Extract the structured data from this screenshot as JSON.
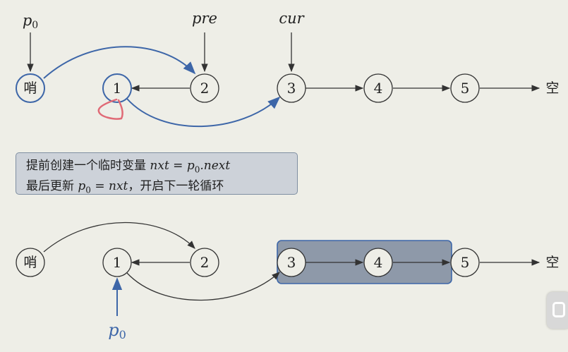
{
  "colors": {
    "background": "#eeeee7",
    "node_fill": "#eeeee7",
    "node_stroke": "#333333",
    "highlight": "#3d66a8",
    "group_box_fill": "#8e99a9",
    "group_box_stroke": "#3d66a8",
    "note_fill": "#cdd2d9",
    "annotation": "#e06a76"
  },
  "top": {
    "nodes": [
      "哨",
      "1",
      "2",
      "3",
      "4",
      "5"
    ],
    "terminal": "空",
    "pointers": {
      "p0": "p",
      "p0_sub": "0",
      "pre": "pre",
      "cur": "cur"
    }
  },
  "note": {
    "line1_prefix": "提前创建一个临时变量 ",
    "line1_math": "nxt = p",
    "line1_sub": "0",
    "line1_math_tail": ".next",
    "line2_prefix": "最后更新 ",
    "line2_math": "p",
    "line2_sub": "0",
    "line2_math_tail": " = nxt",
    "line2_suffix": "，开启下一轮循环"
  },
  "bottom": {
    "nodes": [
      "哨",
      "1",
      "2",
      "3",
      "4",
      "5"
    ],
    "terminal": "空",
    "pointer_p0": "p",
    "pointer_p0_sub": "0"
  },
  "icons": {
    "player_badge": "video-player-badge-icon"
  }
}
